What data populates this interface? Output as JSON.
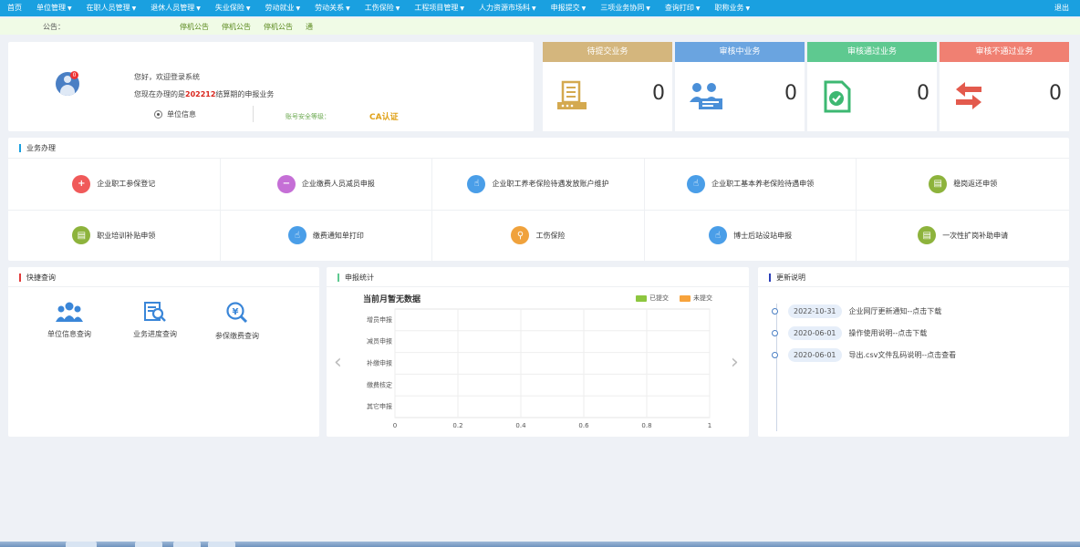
{
  "nav": {
    "items": [
      {
        "label": "首页",
        "dropdown": false
      },
      {
        "label": "单位管理",
        "dropdown": true
      },
      {
        "label": "在职人员管理",
        "dropdown": true
      },
      {
        "label": "退休人员管理",
        "dropdown": true
      },
      {
        "label": "失业保险",
        "dropdown": true
      },
      {
        "label": "劳动就业",
        "dropdown": true
      },
      {
        "label": "劳动关系",
        "dropdown": true
      },
      {
        "label": "工伤保险",
        "dropdown": true
      },
      {
        "label": "工程项目管理",
        "dropdown": true
      },
      {
        "label": "人力资源市场科",
        "dropdown": true
      },
      {
        "label": "申报提交",
        "dropdown": true
      },
      {
        "label": "三项业务协同",
        "dropdown": true
      },
      {
        "label": "查询打印",
        "dropdown": true
      },
      {
        "label": "职称业务",
        "dropdown": true
      }
    ],
    "caret": "▼",
    "logout": "退出"
  },
  "notice": {
    "label": "公告：",
    "items": [
      "停机公告",
      "停机公告",
      "停机公告",
      "通"
    ]
  },
  "welcome": {
    "badge": "0",
    "greeting": "您好，欢迎登录系统",
    "period_prefix": "您现在办理的是",
    "period": "202212",
    "period_suffix": "结算期的申报业务",
    "unit_info": "单位信息",
    "security_label": "账号安全等级：",
    "ca_label": "CA认证"
  },
  "stats": [
    {
      "title": "待提交业务",
      "value": "0",
      "color": "#d4b67d",
      "icon": "document-stack-icon"
    },
    {
      "title": "审核中业务",
      "value": "0",
      "color": "#6aa4e0",
      "icon": "users-group-icon"
    },
    {
      "title": "审核通过业务",
      "value": "0",
      "color": "#5ec990",
      "icon": "check-document-icon"
    },
    {
      "title": "审核不通过业务",
      "value": "0",
      "color": "#f08072",
      "icon": "return-arrows-icon"
    }
  ],
  "business": {
    "title": "业务办理",
    "accent": "#1aa0e0",
    "items": [
      {
        "label": "企业职工参保登记",
        "color": "#f05a5a",
        "icon": "person-plus-icon"
      },
      {
        "label": "企业缴费人员减员申报",
        "color": "#c56fd6",
        "icon": "person-minus-icon"
      },
      {
        "label": "企业职工养老保险待遇发放账户维护",
        "color": "#4a9ee8",
        "icon": "hand-pointer-icon"
      },
      {
        "label": "企业职工基本养老保险待遇申领",
        "color": "#4a9ee8",
        "icon": "hand-pointer-icon"
      },
      {
        "label": "稳岗返还申领",
        "color": "#8db33c",
        "icon": "document-icon"
      },
      {
        "label": "职业培训补贴申领",
        "color": "#8db33c",
        "icon": "document-icon"
      },
      {
        "label": "缴费通知单打印",
        "color": "#4a9ee8",
        "icon": "hand-pointer-icon"
      },
      {
        "label": "工伤保险",
        "color": "#f0a23c",
        "icon": "search-icon"
      },
      {
        "label": "博士后站设站申报",
        "color": "#4a9ee8",
        "icon": "hand-pointer-icon"
      },
      {
        "label": "一次性扩岗补助申请",
        "color": "#8db33c",
        "icon": "document-icon"
      }
    ]
  },
  "quick": {
    "title": "快捷查询",
    "accent": "#e33b3b",
    "items": [
      {
        "label": "单位信息查询",
        "icon": "people-icon"
      },
      {
        "label": "业务进度查询",
        "icon": "progress-search-icon"
      },
      {
        "label": "参保缴费查询",
        "icon": "yuan-search-icon"
      }
    ]
  },
  "report": {
    "title": "申报统计",
    "accent": "#5ec990",
    "prev": "‹",
    "next": "›"
  },
  "chart_data": {
    "type": "bar",
    "title": "当前月暂无数据",
    "categories": [
      "增员申报",
      "减员申报",
      "补缴申报",
      "缴费核定",
      "其它申报"
    ],
    "series": [
      {
        "name": "已提交",
        "color": "#8dc63f",
        "values": [
          0,
          0,
          0,
          0,
          0
        ]
      },
      {
        "name": "未提交",
        "color": "#f7a33c",
        "values": [
          0,
          0,
          0,
          0,
          0
        ]
      }
    ],
    "xlim": [
      0,
      1
    ],
    "xticks": [
      "0",
      "0.2",
      "0.4",
      "0.6",
      "0.8",
      "1"
    ],
    "orientation": "horizontal",
    "grid": true,
    "legend": "top-right"
  },
  "updates": {
    "title": "更新说明",
    "accent": "#2b3fb8",
    "items": [
      {
        "date": "2022-10-31",
        "text": "企业网厅更新通知--点击下载"
      },
      {
        "date": "2020-06-01",
        "text": "操作使用说明--点击下载"
      },
      {
        "date": "2020-06-01",
        "text": "导出.csv文件乱码说明--点击查看"
      }
    ]
  }
}
